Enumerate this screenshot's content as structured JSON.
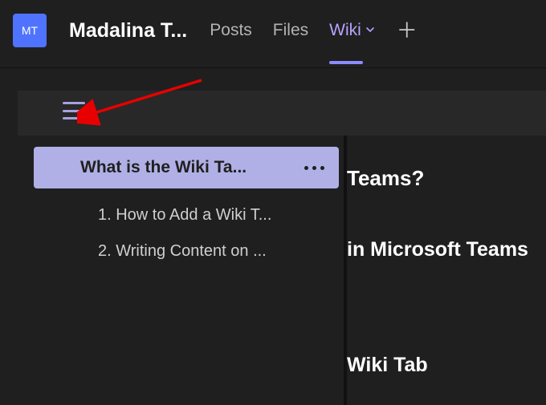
{
  "header": {
    "avatar_initials": "MT",
    "team_name": "Madalina T...",
    "tabs": {
      "posts": "Posts",
      "files": "Files",
      "wiki": "Wiki"
    }
  },
  "sidebar": {
    "selected_title": "What is the Wiki Ta...",
    "toc": [
      "1. How to Add a Wiki T...",
      "2. Writing Content on ..."
    ]
  },
  "content": {
    "line1": " Teams?",
    "line2": "in Microsoft Teams",
    "line3": "Wiki Tab"
  }
}
